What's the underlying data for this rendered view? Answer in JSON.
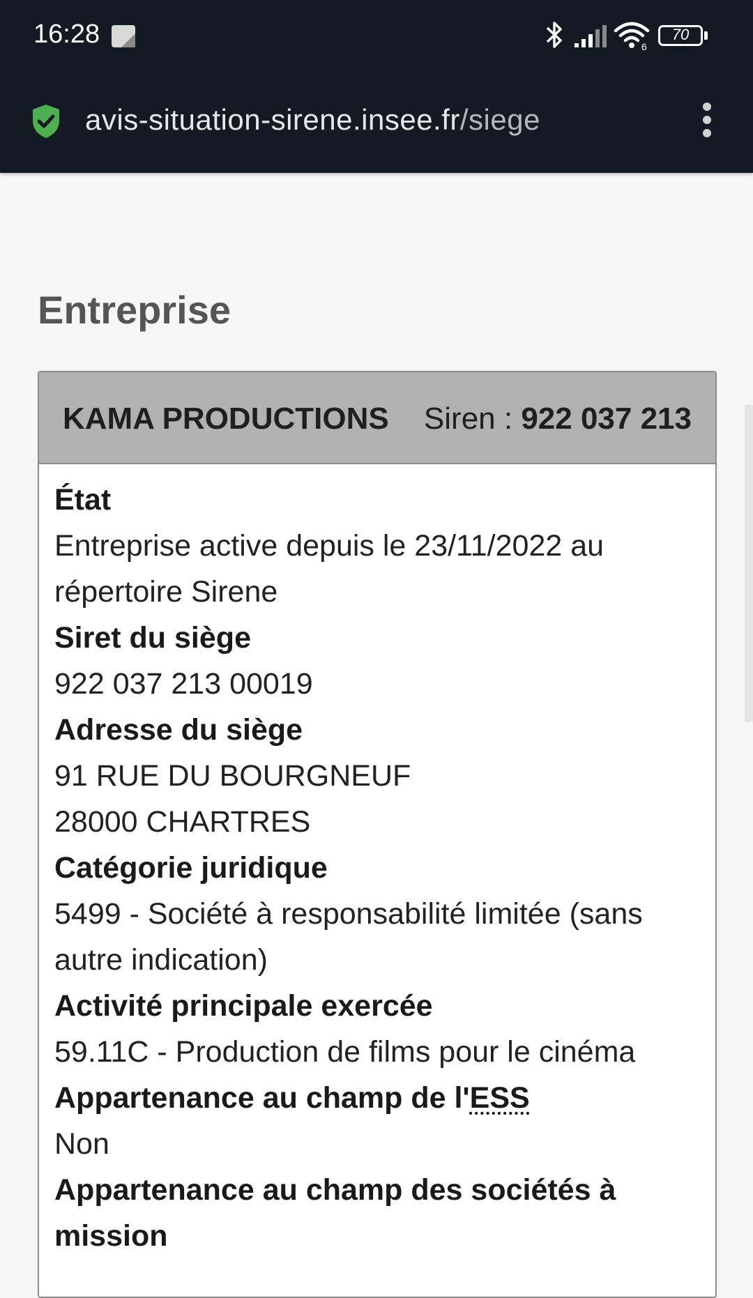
{
  "status_bar": {
    "time": "16:28",
    "battery_percent": "70",
    "icons": [
      "notification-icon",
      "bluetooth-icon",
      "signal-icon",
      "wifi-icon",
      "battery-icon"
    ],
    "wifi_badge": "6"
  },
  "browser": {
    "url_domain": "avis-situation-sirene.insee.fr",
    "url_path": "/siege",
    "secure_icon": "shield-check-icon",
    "menu_icon": "more-vert-icon",
    "colors": {
      "toolbar": "#141a24",
      "shield": "#4caf50"
    }
  },
  "page": {
    "heading": "Entreprise"
  },
  "card": {
    "company_name": "KAMA PRODUCTIONS",
    "siren_label": "Siren : ",
    "siren_number": "922 037 213",
    "fields": {
      "etat_label": "État",
      "etat_value": "Entreprise active depuis le 23/11/2022 au répertoire Sirene",
      "siret_label": "Siret du siège",
      "siret_value": "922 037 213 00019",
      "adresse_label": "Adresse du siège",
      "adresse_line1": "91 RUE DU BOURGNEUF",
      "adresse_line2": "28000 CHARTRES",
      "categorie_label": "Catégorie juridique",
      "categorie_value": "5499 - Société à responsabilité limitée (sans autre indication)",
      "activite_label": "Activité principale exercée",
      "activite_value": "59.11C - Production de films pour le cinéma",
      "ess_label_prefix": "Appartenance au champ de l'",
      "ess_label_abbr": "ESS",
      "ess_value": "Non",
      "mission_label": "Appartenance au champ des sociétés à mission"
    }
  }
}
